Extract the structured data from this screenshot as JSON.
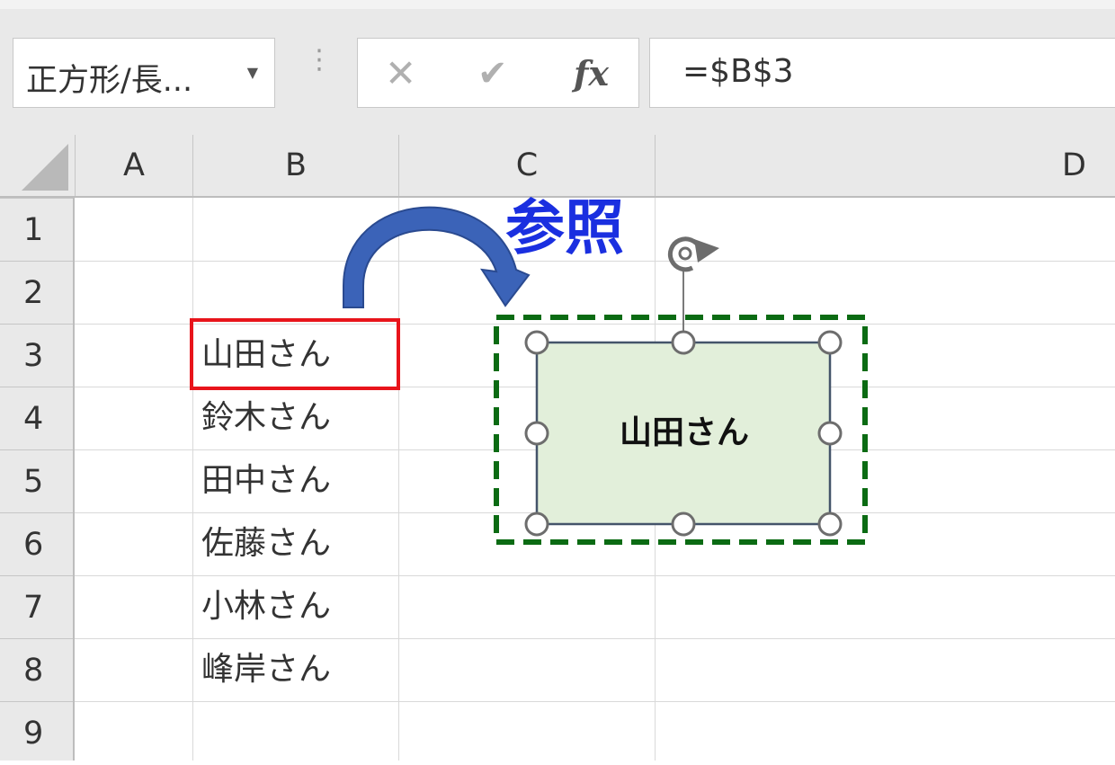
{
  "formula_bar": {
    "name_box_value": "正方形/長...",
    "formula": "=$B$3",
    "fx_label": "fx"
  },
  "columns": [
    "A",
    "B",
    "C",
    "D"
  ],
  "rows": [
    "1",
    "2",
    "3",
    "4",
    "5",
    "6",
    "7",
    "8",
    "9"
  ],
  "cells": {
    "B3": "山田さん",
    "B4": "鈴木さん",
    "B5": "田中さん",
    "B6": "佐藤さん",
    "B7": "小林さん",
    "B8": "峰岸さん"
  },
  "shape": {
    "text": "山田さん",
    "fill_color": "#e2efda",
    "selection_border_color": "#0b6b13"
  },
  "annotation": {
    "label": "参照",
    "label_color": "#1a2fe0",
    "arrow_color": "#3b63b8",
    "highlight_color": "#e8141b"
  }
}
